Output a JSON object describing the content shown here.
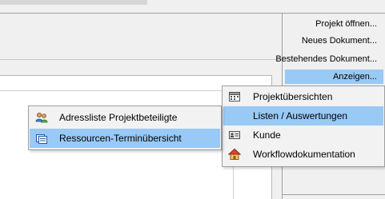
{
  "panel": {
    "commands": [
      {
        "label": "Projekt öffnen..."
      },
      {
        "label": "Neues Dokument..."
      },
      {
        "label": "Bestehendes Dokument..."
      },
      {
        "label": "Anzeigen..."
      }
    ],
    "selected_index": 3
  },
  "main_menu": {
    "items": [
      {
        "label": "Projektübersichten",
        "icon": "calendar-icon"
      },
      {
        "label": "Listen / Auswertungen",
        "icon": "none"
      },
      {
        "label": "Kunde",
        "icon": "id-card-icon"
      },
      {
        "label": "Workflowdokumentation",
        "icon": "house-icon"
      }
    ],
    "selected_index": 1
  },
  "sub_menu": {
    "items": [
      {
        "label": "Adressliste Projektbeteiligte",
        "icon": "people-icon"
      },
      {
        "label": "Ressourcen-Terminübersicht",
        "icon": "resource-schedule-icon"
      }
    ],
    "selected_index": 1
  },
  "colors": {
    "highlight": "#99c9f5",
    "menu_background": "#f2f2f2",
    "panel_background": "#f0f0f0"
  }
}
